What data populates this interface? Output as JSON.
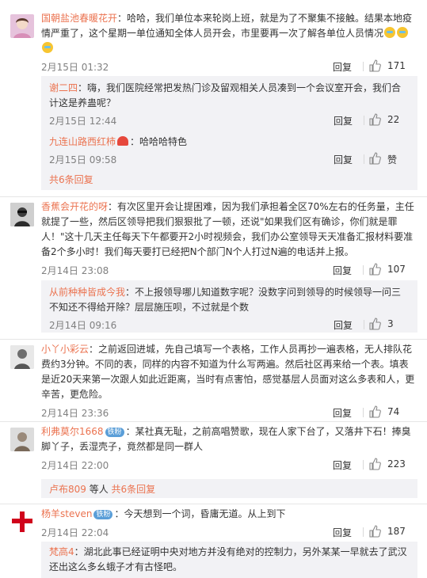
{
  "comments": [
    {
      "user": "国朝盐池春暖花开",
      "text": "：哈哈，我们单位本来轮岗上班，就是为了不聚集不接触。结果本地疫情严重了，这个星期一单位通知全体人员开会，市里要再一次了解各单位人员情况",
      "time": "2月15日 01:32",
      "reply": "回复",
      "likes": "171",
      "avatar_color": "#c8a2c8",
      "replies": [
        {
          "user": "谢二四",
          "text": "：嗨，我们医院经常把发热门诊及留观相关人员凑到一个会议室开会，我们合计这是养蛊呢？",
          "time": "2月15日 12:44",
          "reply": "回复",
          "likes": "22"
        },
        {
          "user": "九连山路西红柿",
          "text": "：哈哈哈特色",
          "time": "2月15日 09:58",
          "reply": "回复",
          "likes": "赞"
        }
      ],
      "more": "共6条回复"
    },
    {
      "user": "香蕉会开花的呀",
      "text": "：有次区里开会让提困难，因为我们承担着全区70%左右的任务量，主任就提了一些，然后区领导把我们狠狠批了一顿，还说\"如果我们区有确诊，你们就是罪人！\"这十几天主任每天下午都要开2小时视频会，我们办公室领导天天准备汇报材料要准备2个多小时！我们每天要打已经把N个部门N个人打过N遍的电话并上报。",
      "time": "2月14日 23:08",
      "reply": "回复",
      "likes": "107",
      "avatar_color": "#5a5a5a",
      "replies": [
        {
          "user": "从前种种皆成今我",
          "text": "：不上报领导哪儿知道数字呢？没数字问到领导的时候领导一问三不知还不得给开除？层层施压呗，不过就是个数",
          "time": "2月14日 09:16",
          "reply": "回复",
          "likes": "3"
        }
      ]
    },
    {
      "user": "小丫小彩云",
      "text": "：之前返回进城，先自己填写一个表格，工作人员再抄一遍表格，无人排队花费约3分钟。不同的表，同样的内容不知道为什么写两遍。然后社区再来给一个表。填表是近20天来第一次跟人如此近距离，当时有点害怕，感觉基层人员面对这么多表和人，更辛苦，更危险。",
      "time": "2月14日 23:36",
      "reply": "回复",
      "likes": "74",
      "avatar_color": "#9a9a9a"
    },
    {
      "user": "利弗莫尔1668",
      "badge": "铁粉",
      "text": "：某社真无耻，之前高唱赞歌，现在人家下台了，又落井下石！捧臭脚丫子，丢湿壳子，竟然都是同一群人",
      "time": "2月14日 22:00",
      "reply": "回复",
      "likes": "223",
      "avatar_color": "#b0b0b0",
      "more_prefix": "卢布809",
      "more_mid": " 等人 ",
      "more": "共6条回复"
    },
    {
      "user": "杨羊steven",
      "badge": "铁粉",
      "text": "：今天想到一个词，昏庸无道。从上到下",
      "time": "2月14日 22:04",
      "reply": "回复",
      "likes": "187",
      "avatar_color": "#d0021b",
      "replies": [
        {
          "user": "梵高4",
          "text": "：湖北此事已经证明中央对地方并没有绝对的控制力，另外某某一早就去了武汉还出这么多幺蛾子才有古怪吧。"
        }
      ]
    }
  ]
}
